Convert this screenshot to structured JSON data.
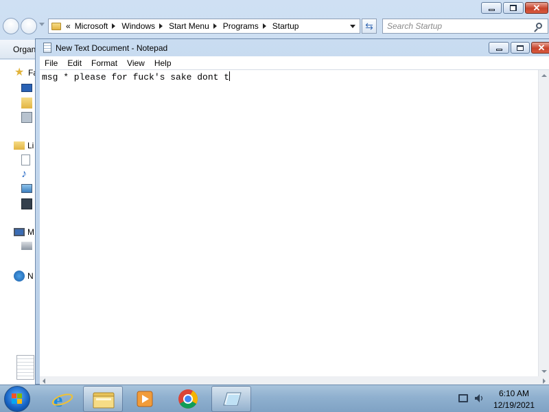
{
  "explorer": {
    "address_crumbs": [
      "«",
      "Microsoft",
      "Windows",
      "Start Menu",
      "Programs",
      "Startup"
    ],
    "search_placeholder": "Search Startup",
    "toolbar_label": "Organ",
    "nav_items": [
      {
        "label": "Fa",
        "icon": "favorites-star-icon"
      },
      {
        "label": "",
        "icon": "desktop-icon"
      },
      {
        "label": "",
        "icon": "downloads-icon"
      },
      {
        "label": "",
        "icon": "recent-places-icon"
      },
      {
        "label": "Li",
        "icon": "libraries-icon"
      },
      {
        "label": "",
        "icon": "documents-icon"
      },
      {
        "label": "",
        "icon": "music-icon"
      },
      {
        "label": "",
        "icon": "pictures-icon"
      },
      {
        "label": "",
        "icon": "videos-icon"
      },
      {
        "label": "M",
        "icon": "computer-icon"
      },
      {
        "label": "",
        "icon": "local-disk-icon"
      },
      {
        "label": "N",
        "icon": "network-icon"
      }
    ]
  },
  "notepad": {
    "title": "New Text Document - Notepad",
    "menu": [
      "File",
      "Edit",
      "Format",
      "View",
      "Help"
    ],
    "content": "msg * please for fuck's sake dont t"
  },
  "taskbar": {
    "apps": [
      {
        "name": "internet-explorer",
        "active": false
      },
      {
        "name": "windows-explorer",
        "active": true
      },
      {
        "name": "windows-media-player",
        "active": false
      },
      {
        "name": "google-chrome",
        "active": false
      },
      {
        "name": "notepad",
        "active": true
      }
    ],
    "time": "6:10 AM",
    "date": "12/19/2021"
  },
  "colors": {
    "titlebar": "#c9dcf1",
    "taskbar": "#8fb0cf",
    "close_button": "#c7432c"
  }
}
